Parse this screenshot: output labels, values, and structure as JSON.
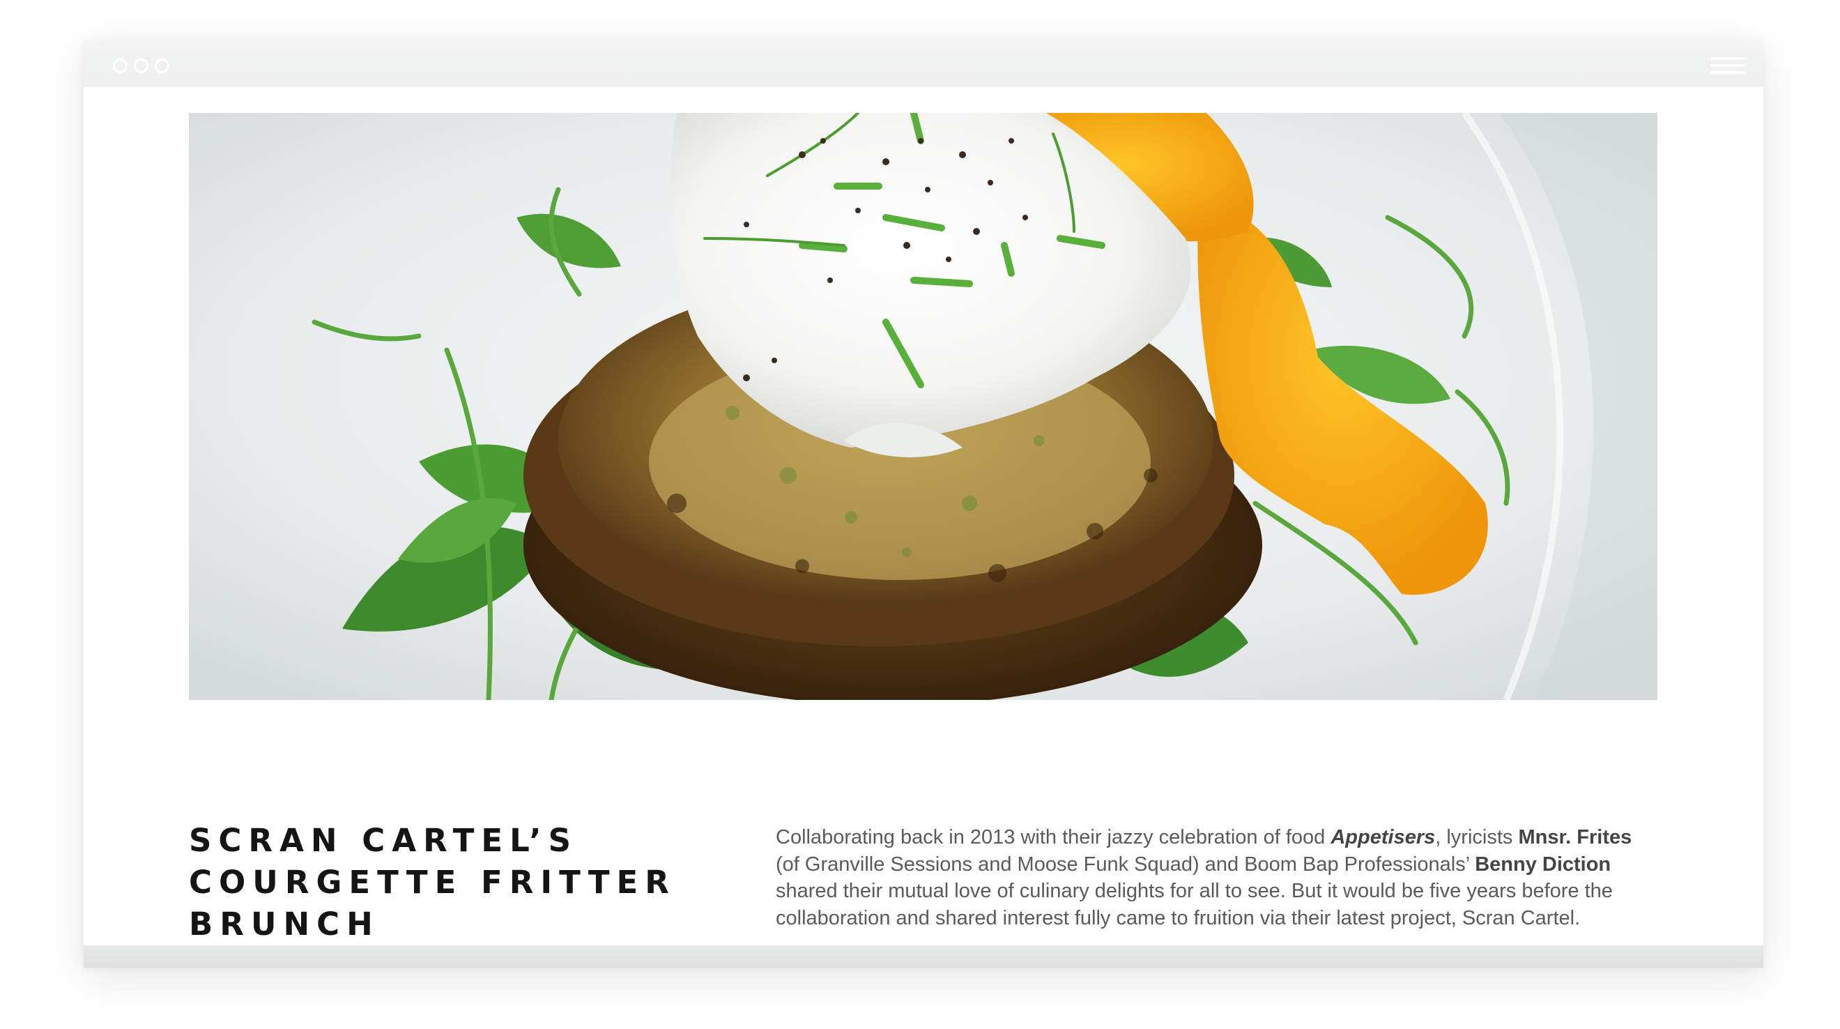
{
  "window": {
    "controls": [
      "close",
      "minimize",
      "maximize"
    ],
    "menu_icon": "hamburger-menu-icon"
  },
  "hero": {
    "image_desc": "hero-photo"
  },
  "article": {
    "title": "SCRAN CARTEL’S COURGETTE FRITTER BRUNCH",
    "body": {
      "p1_a": "Collaborating back in 2013 with their jazzy celebration of food ",
      "p1_appetisers": "Appetisers",
      "p1_b": ", lyricists ",
      "p1_frites": "Mnsr. Frites",
      "p1_c": " (of Granville Sessions and Moose Funk Squad) and Boom Bap Professionals’ ",
      "p1_benny": "Benny Diction",
      "p1_d": " shared their mutual love of culinary delights for all to see. But it would be five years before the collaboration and shared interest fully came to fruition via their latest project, Scran Cartel."
    }
  },
  "colors": {
    "title_text": "#151515",
    "body_text": "#5a5a5a",
    "titlebar": "#f0f1f1",
    "yolk": "#f5a413"
  }
}
